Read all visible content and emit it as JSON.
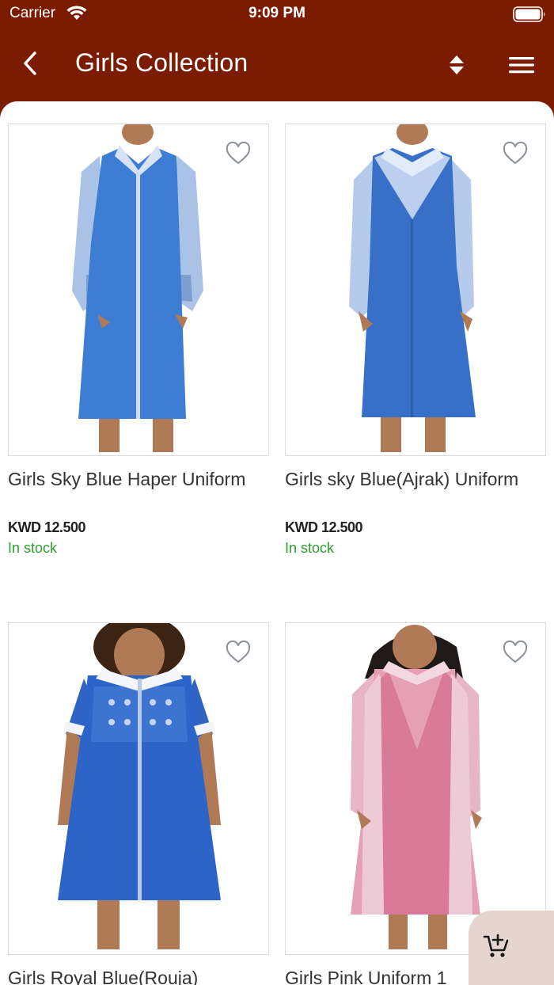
{
  "status_bar": {
    "carrier": "Carrier",
    "time": "9:09 PM"
  },
  "header": {
    "title": "Girls Collection",
    "back_icon": "chevron-left-icon",
    "sort_icon": "sort-icon",
    "menu_icon": "hamburger-menu-icon"
  },
  "colors": {
    "brand": "#7b1c02",
    "in_stock": "#2e9c2e",
    "fab_bg": "#e6d5cf"
  },
  "products": [
    {
      "title": "Girls Sky Blue Haper Uniform",
      "price": "KWD 12.500",
      "stock": "In stock",
      "favorite_icon": "heart-outline-icon"
    },
    {
      "title": "Girls sky Blue(Ajrak) Uniform",
      "price": "KWD 12.500",
      "stock": "In stock",
      "favorite_icon": "heart-outline-icon"
    },
    {
      "title": "Girls Royal Blue(Rouja)",
      "favorite_icon": "heart-outline-icon"
    },
    {
      "title": "Girls Pink Uniform 1",
      "favorite_icon": "heart-outline-icon"
    }
  ],
  "cart_fab": {
    "icon": "add-to-cart-icon"
  }
}
